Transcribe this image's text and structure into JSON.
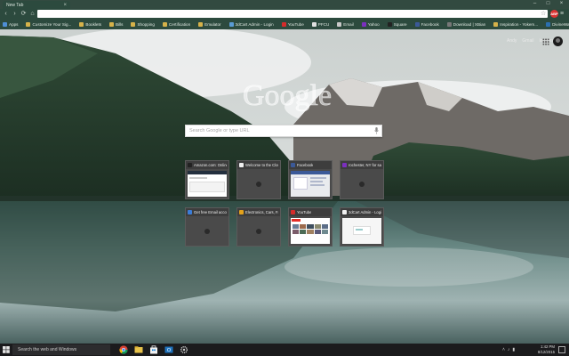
{
  "browser": {
    "tab_title": "New Tab",
    "tab_close": "×",
    "window_controls": [
      "–",
      "□",
      "×"
    ],
    "nav": {
      "back": "‹",
      "forward": "›",
      "reload": "⟳",
      "home": "⌂"
    },
    "url": "",
    "star_icon": "star-icon",
    "extension_badge": "ABP",
    "menu": "≡"
  },
  "bookmarks": [
    {
      "label": "Apps",
      "color": "#4f8fd6"
    },
    {
      "label": "Customize Your Sig...",
      "color": "#d6b24a"
    },
    {
      "label": "Booklets",
      "color": "#d6b24a"
    },
    {
      "label": "Bills",
      "color": "#d6b24a"
    },
    {
      "label": "Shopping",
      "color": "#d6b24a"
    },
    {
      "label": "Certification",
      "color": "#d6b24a"
    },
    {
      "label": "Emulator",
      "color": "#d6b24a"
    },
    {
      "label": "3dCart Admin - Login",
      "color": "#5a9bd5"
    },
    {
      "label": "YouTube",
      "color": "#d62b2b"
    },
    {
      "label": "PFCU",
      "color": "#e0e0e0"
    },
    {
      "label": "Email",
      "color": "#c9c9c9"
    },
    {
      "label": "Yahoo",
      "color": "#7b2fbf"
    },
    {
      "label": "Square",
      "color": "#222222"
    },
    {
      "label": "Facebook",
      "color": "#3b5998"
    },
    {
      "label": "Download | XBian",
      "color": "#777777"
    },
    {
      "label": "Inspiration - Yokem...",
      "color": "#d6b24a"
    },
    {
      "label": "DivineWatch.com - P...",
      "color": "#2b6fb0"
    },
    {
      "label": "Slayin' Alive: Upgrac...",
      "color": "#4aa0d6"
    }
  ],
  "ntp": {
    "top_links": [
      "Andy",
      "Gmail",
      "Images"
    ],
    "logo_text": "Google",
    "search_placeholder": "Search Google or type URL",
    "tiles": [
      {
        "title": "Amazon.com: Online...",
        "favicon": "#222222",
        "thumb": "amazon"
      },
      {
        "title": "Welcome to the Cloud...",
        "favicon": "#f0f0f0",
        "thumb": "empty"
      },
      {
        "title": "Facebook",
        "favicon": "#3b5998",
        "thumb": "facebook"
      },
      {
        "title": "rochester, NY for sale...",
        "favicon": "#7b2fbf",
        "thumb": "empty"
      },
      {
        "title": "Get free Email accounts...",
        "favicon": "#3b7dd8",
        "thumb": "empty"
      },
      {
        "title": "Electronics, Cars, Fash...",
        "favicon": "#e4a21b",
        "thumb": "empty"
      },
      {
        "title": "YouTube",
        "favicon": "#d62b2b",
        "thumb": "youtube"
      },
      {
        "title": "3dCart Admin - Login",
        "favicon": "#f2f2f2",
        "thumb": "cart"
      }
    ]
  },
  "taskbar": {
    "search_placeholder": "Search the web and Windows",
    "time": "1:42 PM",
    "date": "8/12/2015",
    "icons": [
      "chrome-icon",
      "file-explorer-icon",
      "store-icon",
      "outlook-icon",
      "settings-icon"
    ]
  }
}
